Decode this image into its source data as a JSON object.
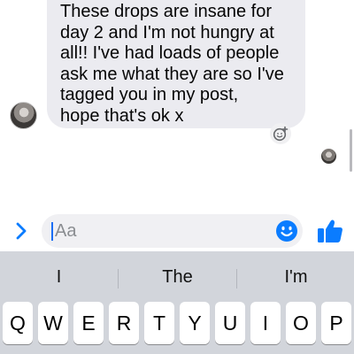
{
  "conversation": {
    "incoming_message_lines": [
      "These drops are insane for",
      "day 2 and I'm not hungry at",
      "all!! I've had loads of people",
      "ask me what they are so I've",
      "tagged you in my post,",
      "hope that's ok x"
    ],
    "icons": {
      "sender_avatar": "avatar",
      "react": "add-reaction-icon",
      "seen": "seen-avatar"
    }
  },
  "composer": {
    "placeholder": "Aa",
    "icons": {
      "expand": "chevron-right-icon",
      "emoji": "emoji-icon",
      "like": "thumbs-up-icon"
    },
    "accent_color": "#0a7cff"
  },
  "keyboard": {
    "suggestions": [
      "I",
      "The",
      "I'm"
    ],
    "top_row_keys": [
      "Q",
      "W",
      "E",
      "R",
      "T",
      "Y",
      "U",
      "I",
      "O",
      "P"
    ]
  }
}
